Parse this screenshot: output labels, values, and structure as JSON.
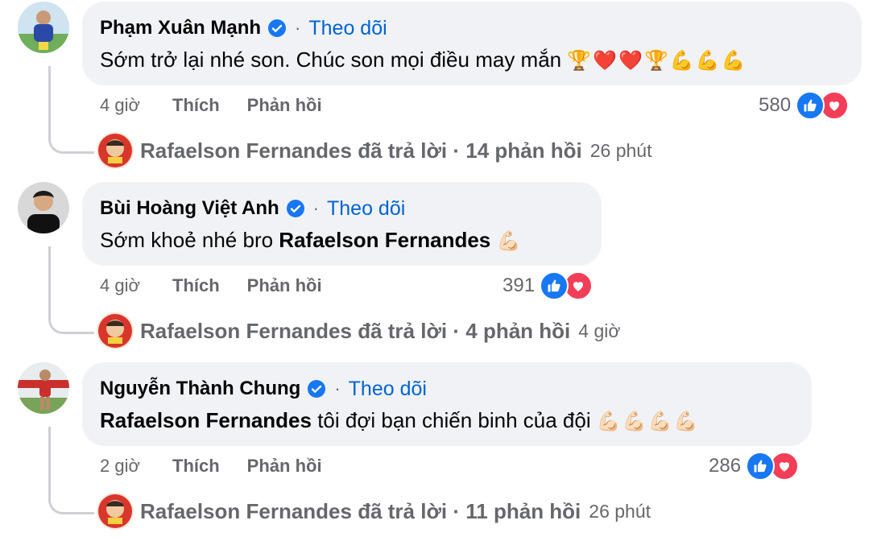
{
  "comments": [
    {
      "author": "Phạm Xuân Mạnh",
      "follow": "Theo dõi",
      "text": "Sớm trở lại nhé son. Chúc son mọi điều may mắn ",
      "emoji": "🏆❤️❤️🏆💪💪💪",
      "time": "4 giờ",
      "like_label": "Thích",
      "reply_label": "Phản hồi",
      "reaction_count": "580",
      "reply_summary": "Rafaelson Fernandes đã trả lời · 14 phản hồi",
      "reply_time": "26 phút"
    },
    {
      "author": "Bùi Hoàng Việt Anh",
      "follow": "Theo dõi",
      "text": "Sớm khoẻ nhé bro ",
      "mention": "Rafaelson Fernandes",
      "emoji": "💪🏻",
      "time": "4 giờ",
      "like_label": "Thích",
      "reply_label": "Phản hồi",
      "reaction_count": "391",
      "reply_summary": "Rafaelson Fernandes đã trả lời · 4 phản hồi",
      "reply_time": "4 giờ"
    },
    {
      "author": "Nguyễn Thành Chung",
      "follow": "Theo dõi",
      "mention": "Rafaelson Fernandes",
      "text": " tôi đợi bạn chiến binh của đội ",
      "emoji": "💪🏻💪🏻💪🏻💪🏻",
      "time": "2 giờ",
      "like_label": "Thích",
      "reply_label": "Phản hồi",
      "reaction_count": "286",
      "reply_summary": "Rafaelson Fernandes đã trả lời · 11 phản hồi",
      "reply_time": "26 phút"
    }
  ],
  "colors": {
    "bubble": "#f0f2f5",
    "link": "#0064d1",
    "meta": "#65676b",
    "like": "#1877f2",
    "love": "#f33e58"
  }
}
